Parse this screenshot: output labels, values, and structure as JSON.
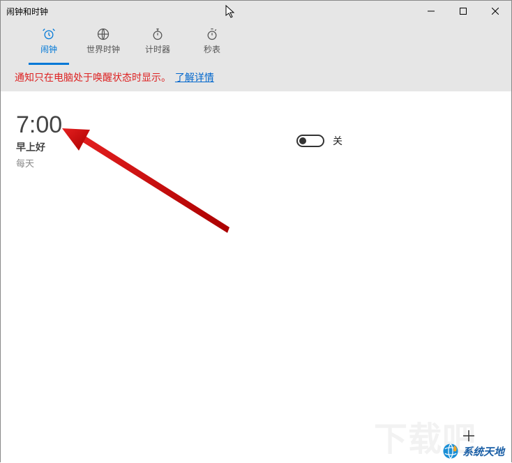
{
  "window": {
    "title": "闹钟和时钟"
  },
  "tabs": {
    "alarm": "闹钟",
    "world_clock": "世界时钟",
    "timer": "计时器",
    "stopwatch": "秒表"
  },
  "notice": {
    "text": "通知只在电脑处于唤醒状态时显示。",
    "link": "了解详情"
  },
  "alarm": {
    "time": "7:00",
    "name": "早上好",
    "repeat": "每天",
    "state_label": "关"
  },
  "watermark": {
    "text": "系统天地"
  }
}
